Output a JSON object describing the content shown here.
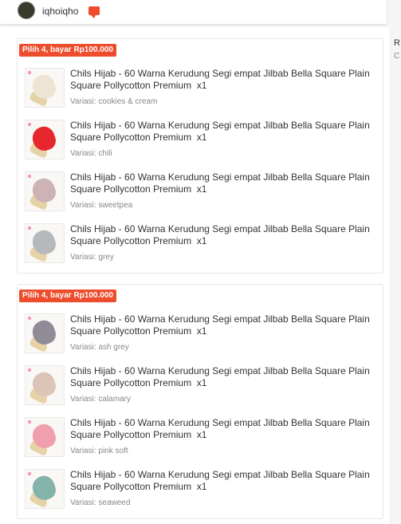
{
  "header": {
    "shop_name": "iqhoiqho",
    "right_line1": "R",
    "right_line2": "C"
  },
  "bundles": [
    {
      "badge": "Pilih 4, bayar Rp100.000",
      "items": [
        {
          "title": "Chils Hijab - 60 Warna Kerudung Segi empat Jilbab Bella Square Plain Square Pollycotton Premium",
          "qty": "x1",
          "variant": "Variasi: cookies & cream",
          "color": "#ede4d4"
        },
        {
          "title": "Chils Hijab - 60 Warna Kerudung Segi empat Jilbab Bella Square Plain Square Pollycotton Premium",
          "qty": "x1",
          "variant": "Variasi: chili",
          "color": "#e8262e"
        },
        {
          "title": "Chils Hijab - 60 Warna Kerudung Segi empat Jilbab Bella Square Plain Square Pollycotton Premium",
          "qty": "x1",
          "variant": "Variasi: sweetpea",
          "color": "#cdb3b6"
        },
        {
          "title": "Chils Hijab - 60 Warna Kerudung Segi empat Jilbab Bella Square Plain Square Pollycotton Premium",
          "qty": "x1",
          "variant": "Variasi: grey",
          "color": "#b6b9bc"
        }
      ]
    },
    {
      "badge": "Pilih 4, bayar Rp100.000",
      "items": [
        {
          "title": "Chils Hijab - 60 Warna Kerudung Segi empat Jilbab Bella Square Plain Square Pollycotton Premium",
          "qty": "x1",
          "variant": "Variasi: ash grey",
          "color": "#8f8c97"
        },
        {
          "title": "Chils Hijab - 60 Warna Kerudung Segi empat Jilbab Bella Square Plain Square Pollycotton Premium",
          "qty": "x1",
          "variant": "Variasi: calamary",
          "color": "#dcc4b7"
        },
        {
          "title": "Chils Hijab - 60 Warna Kerudung Segi empat Jilbab Bella Square Plain Square Pollycotton Premium",
          "qty": "x1",
          "variant": "Variasi: pink soft",
          "color": "#ef9fae"
        },
        {
          "title": "Chils Hijab - 60 Warna Kerudung Segi empat Jilbab Bella Square Plain Square Pollycotton Premium",
          "qty": "x1",
          "variant": "Variasi: seaweed",
          "color": "#84b3ab"
        }
      ]
    }
  ]
}
